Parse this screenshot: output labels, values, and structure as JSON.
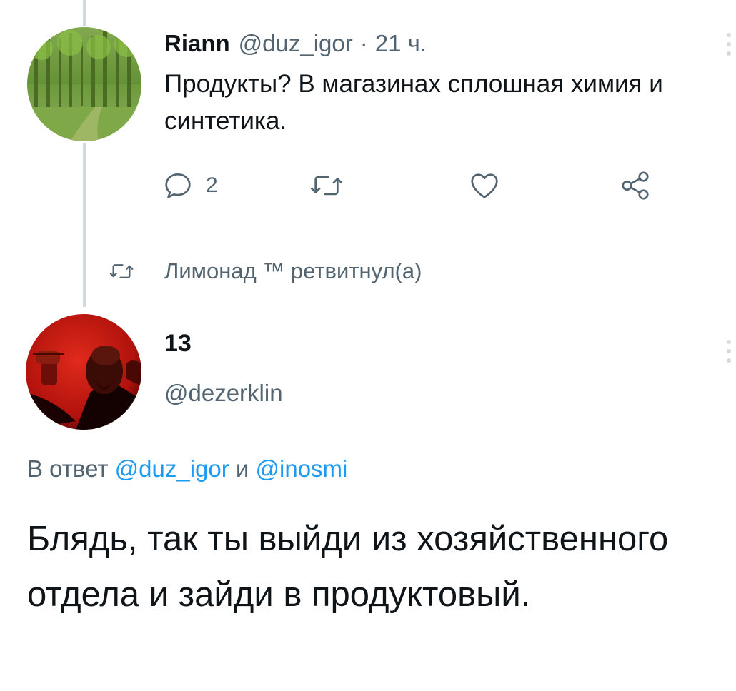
{
  "first_tweet": {
    "display_name": "Riann",
    "handle": "@duz_igor",
    "separator": "·",
    "time": "21 ч.",
    "text": "Продукты?  В магазинах сплошная химия и синтетика.",
    "actions": {
      "reply_count": "2",
      "retweet_count": "",
      "like_count": ""
    },
    "avatar_icon": "forest-avatar",
    "more_icon": "more-options-icon"
  },
  "retweet_banner": {
    "text": "Лимонад ™ ретвитнул(а)",
    "icon": "retweet-icon"
  },
  "second_tweet": {
    "display_name": "13",
    "handle": "@dezerklin",
    "reply_prefix": "В ответ",
    "reply_mention_1": "@duz_igor",
    "reply_and": "и",
    "reply_mention_2": "@inosmi",
    "text": "Блядь, так ты выйди из хозяйственного отдела и зайди в продуктовый.",
    "avatar_icon": "red-portrait-avatar",
    "more_icon": "more-options-icon"
  },
  "colors": {
    "text": "#0f1419",
    "secondary": "#536471",
    "link": "#1d9bf0",
    "thread_line": "#cfd9de"
  }
}
